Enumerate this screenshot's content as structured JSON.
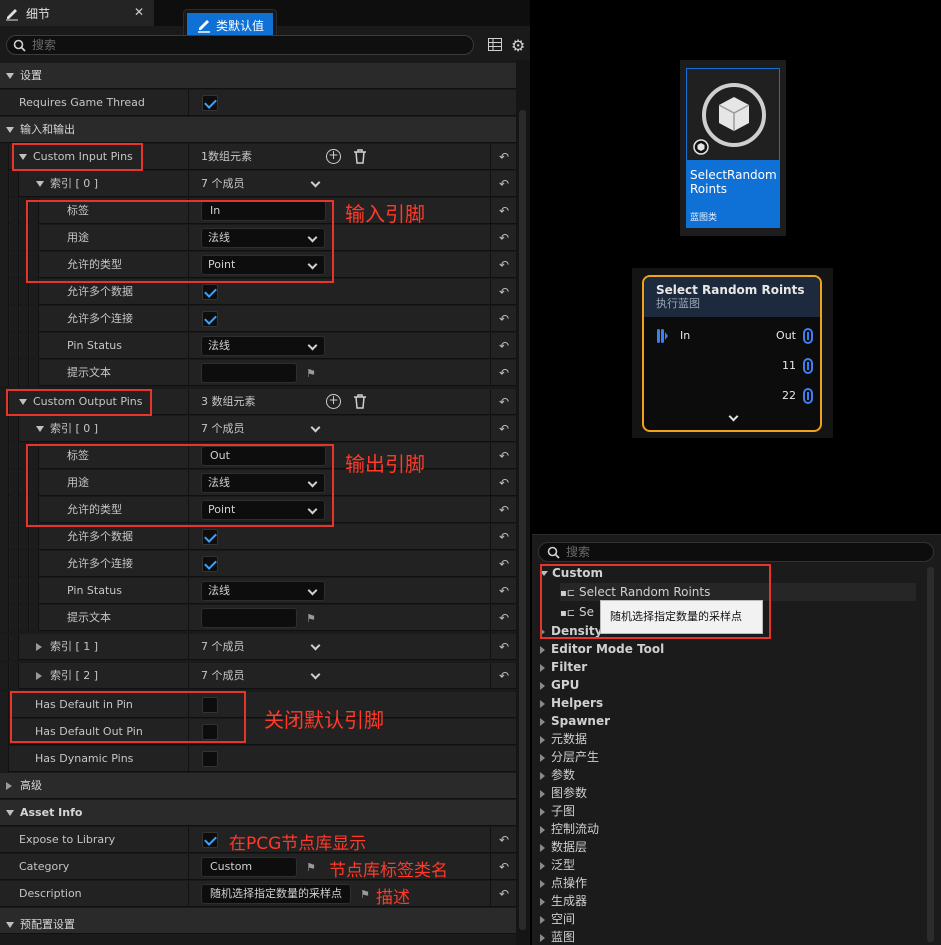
{
  "tab": {
    "title": "细节",
    "close": "✕"
  },
  "class_default_button": "类默认值",
  "search": {
    "placeholder": "搜索"
  },
  "sections": {
    "settings": "设置",
    "io": "输入和输出",
    "advanced": "高级",
    "asset_info": "Asset Info",
    "preset": "预配置设置"
  },
  "props": {
    "requires_game_thread": "Requires Game Thread",
    "custom_input_pins": "Custom Input Pins",
    "input_count": "1数组元素",
    "index0": "索引 [ 0 ]",
    "members7": "7 个成员",
    "label": "标签",
    "usage": "用途",
    "allowed_types": "允许的类型",
    "allow_multi_data": "允许多个数据",
    "allow_multi_conn": "允许多个连接",
    "pin_status": "Pin Status",
    "tooltip_text": "提示文本",
    "custom_output_pins": "Custom Output Pins",
    "output_count": "3 数组元素",
    "index1": "索引 [ 1 ]",
    "index2": "索引 [ 2 ]",
    "has_default_in": "Has Default in Pin",
    "has_default_out": "Has Default Out Pin",
    "has_dynamic": "Has Dynamic Pins",
    "expose": "Expose to Library",
    "category": "Category",
    "description": "Description"
  },
  "values": {
    "in_label": "In",
    "out_label": "Out",
    "usage": "法线",
    "type": "Point",
    "pin_status": "法线",
    "category": "Custom",
    "description": "随机选择指定数量的采样点"
  },
  "annotations": {
    "input_pins": "输入引脚",
    "output_pins": "输出引脚",
    "close_default": "关闭默认引脚",
    "show_in_library": "在PCG节点库显示",
    "category_name": "节点库标签类名",
    "description": "描述"
  },
  "asset": {
    "name": "SelectRandom Roints",
    "type": "蓝图类"
  },
  "node": {
    "title": "Select Random Roints",
    "subtitle": "执行蓝图",
    "in": "In",
    "out": "Out",
    "out2": "11",
    "out3": "22"
  },
  "palette": {
    "placeholder": "搜索",
    "custom": "Custom",
    "item1": "Select Random Roints",
    "item2": "Se",
    "tooltip": "随机选择指定数量的采样点",
    "categories": [
      "Density",
      "Editor Mode Tool",
      "Filter",
      "GPU",
      "Helpers",
      "Spawner",
      "元数据",
      "分层产生",
      "参数",
      "图参数",
      "子图",
      "控制流动",
      "数据层",
      "泛型",
      "点操作",
      "生成器",
      "空间",
      "蓝图"
    ]
  },
  "colors": {
    "accent": "#0f70d6",
    "annotation": "#e8352c",
    "node_border": "#f0a31a"
  }
}
